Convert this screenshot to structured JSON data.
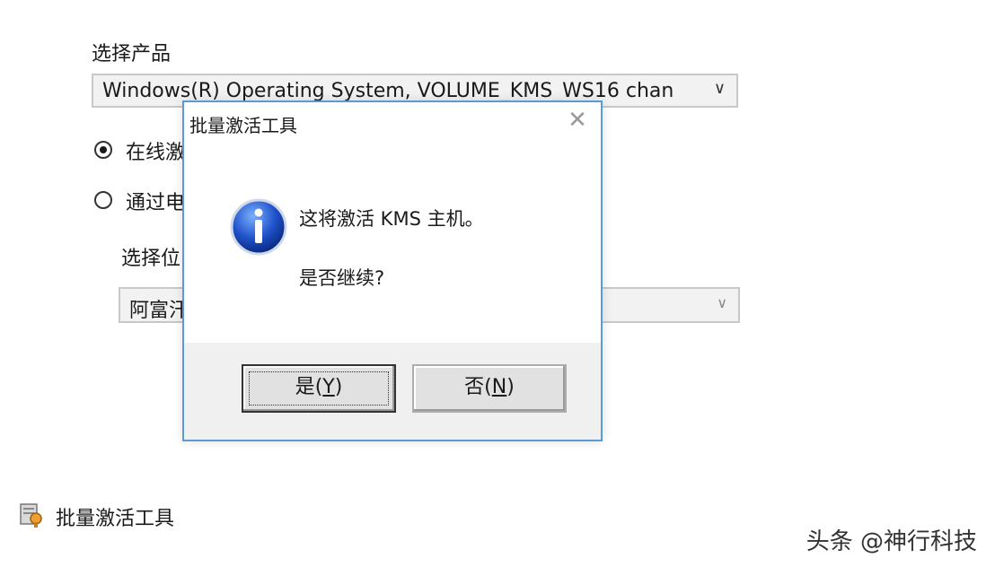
{
  "form": {
    "product_label": "选择产品",
    "product_value": "Windows(R) Operating System, VOLUME_KMS_WS16 chan",
    "radio_online_label": "在线激",
    "radio_phone_label": "通过电",
    "location_label": "选择位",
    "location_value": "阿富汗"
  },
  "dialog": {
    "title": "批量激活工具",
    "message_line1": "这将激活 KMS 主机。",
    "message_line2": "是否继续?",
    "yes_label": "是",
    "yes_key": "Y",
    "no_label": "否",
    "no_key": "N"
  },
  "footer": {
    "tool_label": "批量激活工具"
  },
  "watermark": "头条 @神行科技",
  "icons": {
    "close": "close-icon",
    "info": "info-icon",
    "tool": "volume-activation-tool-icon",
    "dropdown": "chevron-down-icon"
  },
  "colors": {
    "dialog_border": "#5a9ad6",
    "info_blue": "#1e50c8"
  }
}
